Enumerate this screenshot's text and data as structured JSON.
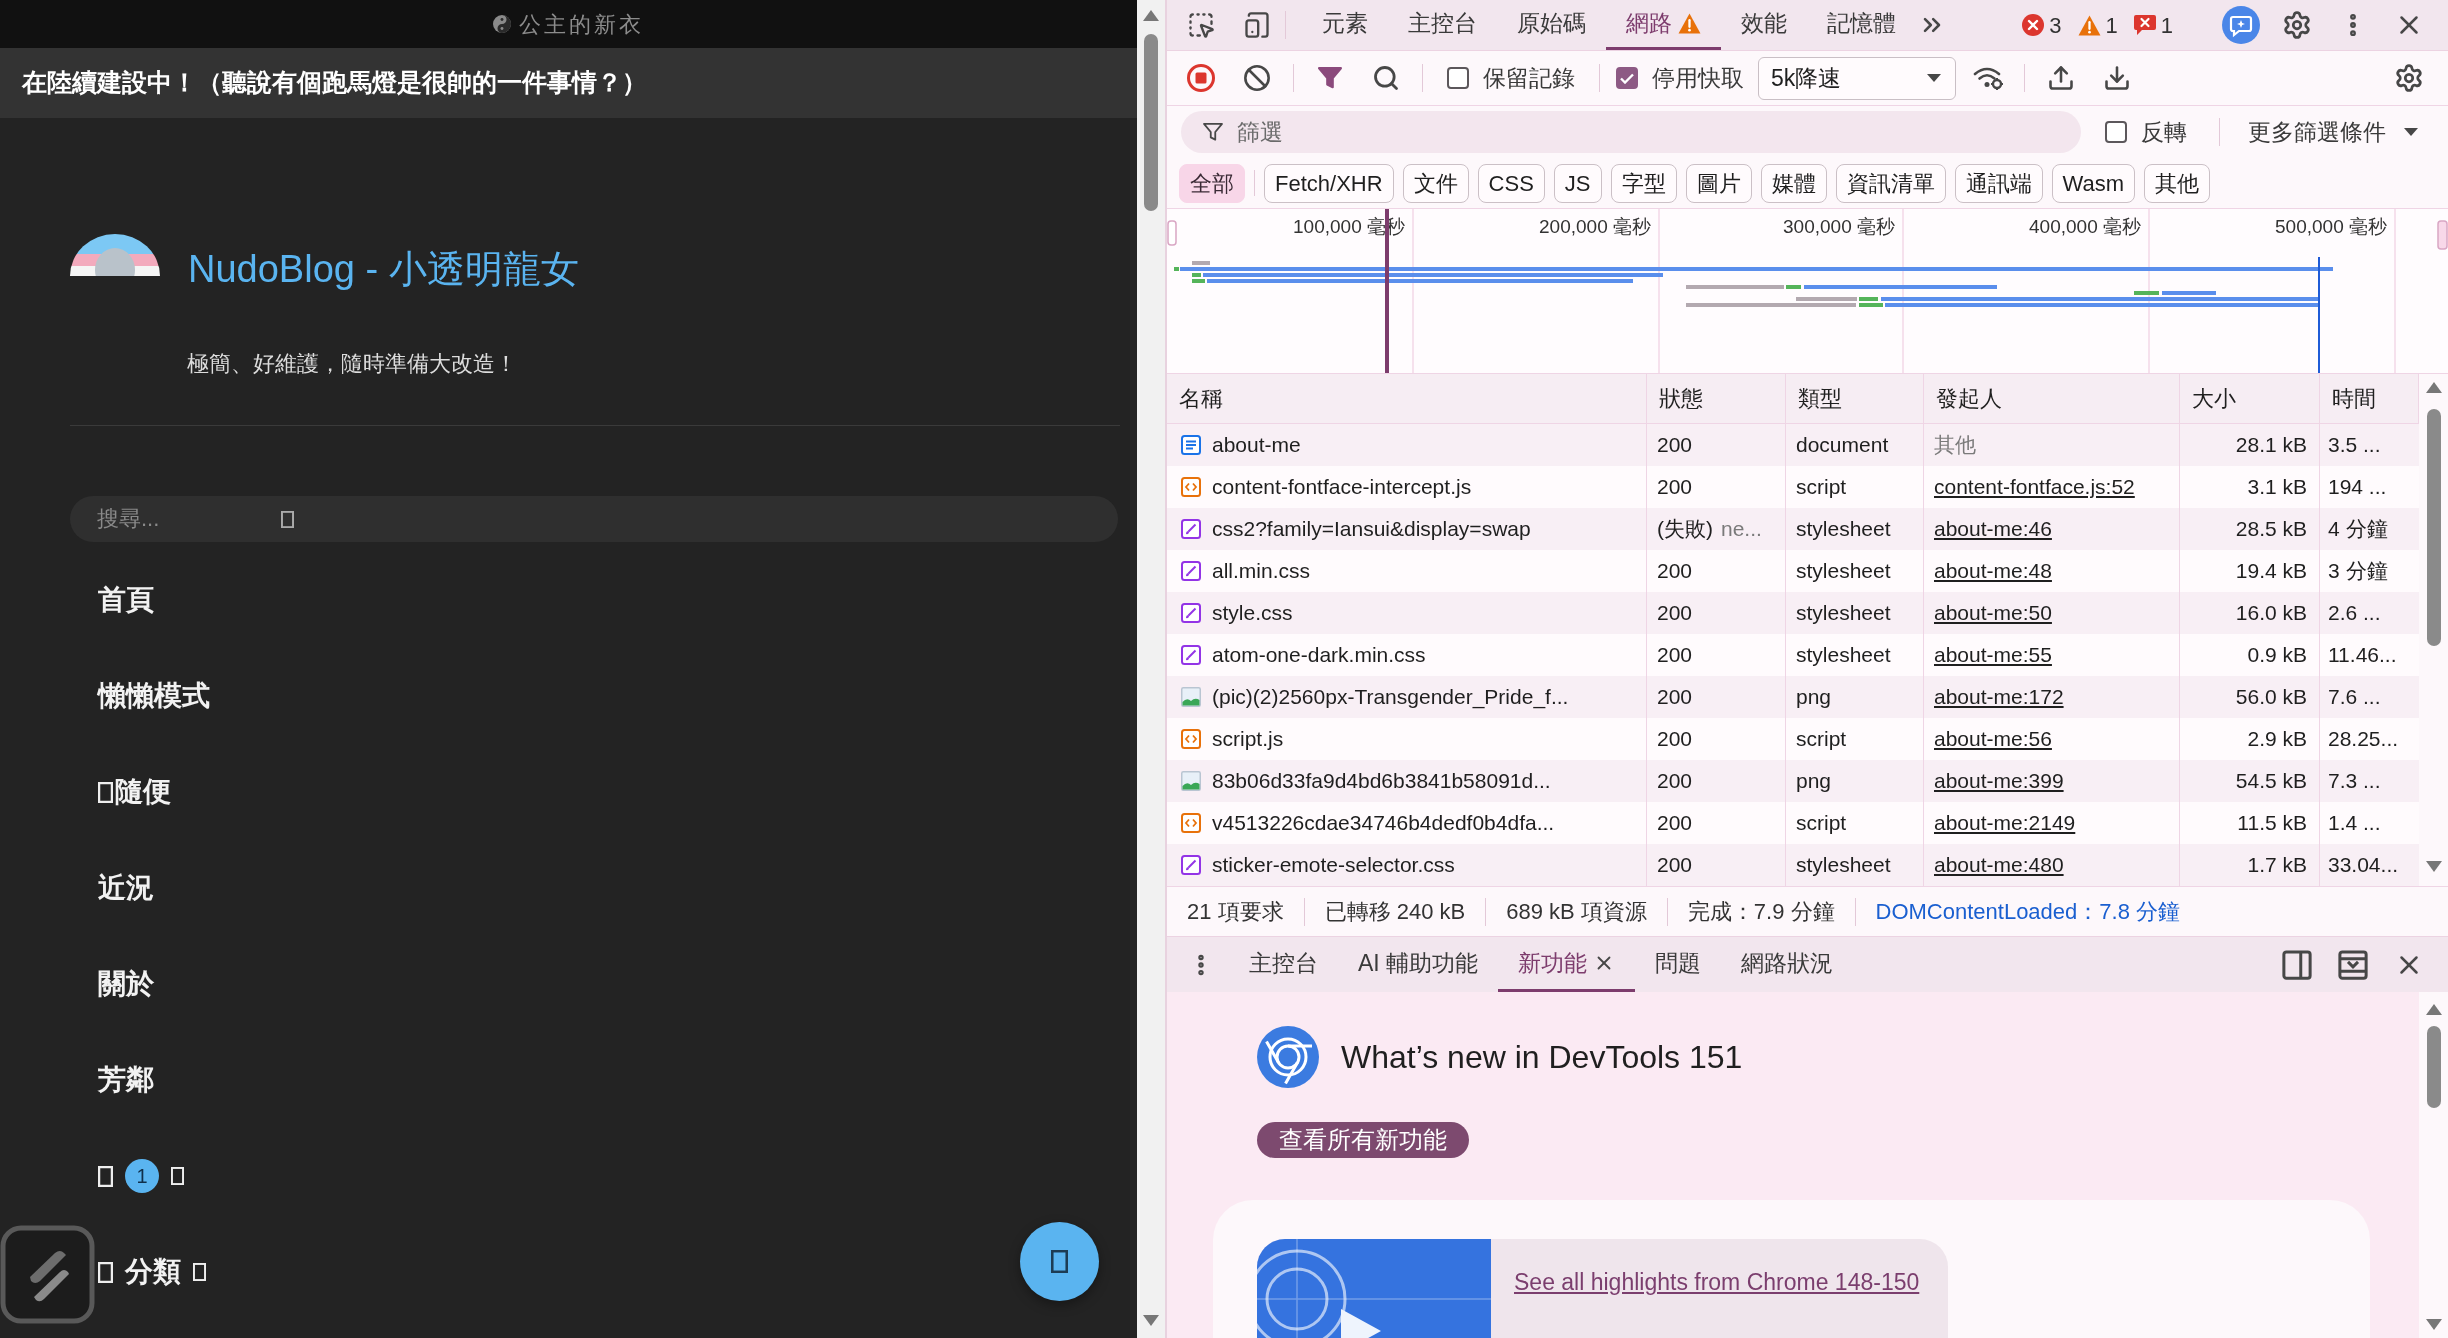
{
  "blog": {
    "top_bar": {
      "title": "公主的新衣"
    },
    "marquee": "在陸續建設中！（聽說有個跑馬燈是很帥的一件事情？）",
    "site_title": "NudoBlog - 小透明龍女",
    "tagline": "極簡、好維護，隨時準備大改造！",
    "search": {
      "placeholder": "搜尋..."
    },
    "nav": [
      {
        "label": "首頁"
      },
      {
        "label": "懶懶模式"
      },
      {
        "label": "隨便",
        "leading_glyph": true
      },
      {
        "label": "近況"
      },
      {
        "label": "關於"
      },
      {
        "label": "芳鄰"
      },
      {
        "badge": "1",
        "leading_glyph": true,
        "trailing_glyph": true
      },
      {
        "label": "分類",
        "leading_glyph": true,
        "trailing_glyph": true
      }
    ]
  },
  "devtools": {
    "main_tabs": [
      {
        "label": "元素",
        "selected": false,
        "warning": false
      },
      {
        "label": "主控台",
        "selected": false,
        "warning": false
      },
      {
        "label": "原始碼",
        "selected": false,
        "warning": false
      },
      {
        "label": "網路",
        "selected": true,
        "warning": true
      },
      {
        "label": "效能",
        "selected": false,
        "warning": false
      },
      {
        "label": "記憶體",
        "selected": false,
        "warning": false
      }
    ],
    "counts": [
      {
        "kind": "error",
        "count": "3"
      },
      {
        "kind": "warning",
        "count": "1"
      },
      {
        "kind": "issue",
        "count": "1"
      }
    ],
    "toolbar": {
      "recording": true,
      "filter_on": true,
      "preserve_log": {
        "label": "保留記錄",
        "checked": false
      },
      "disable_cache": {
        "label": "停用快取",
        "checked": true
      },
      "throttling": {
        "value": "5k降速"
      }
    },
    "filter": {
      "placeholder": "篩選",
      "invert": {
        "label": "反轉",
        "checked": false
      },
      "more_filters": "更多篩選條件"
    },
    "type_filters": [
      {
        "label": "全部",
        "selected": true
      },
      {
        "label": "Fetch/XHR",
        "selected": false
      },
      {
        "label": "文件",
        "selected": false
      },
      {
        "label": "CSS",
        "selected": false
      },
      {
        "label": "JS",
        "selected": false
      },
      {
        "label": "字型",
        "selected": false
      },
      {
        "label": "圖片",
        "selected": false
      },
      {
        "label": "媒體",
        "selected": false
      },
      {
        "label": "資訊清單",
        "selected": false
      },
      {
        "label": "通訊端",
        "selected": false
      },
      {
        "label": "Wasm",
        "selected": false
      },
      {
        "label": "其他",
        "selected": false
      }
    ],
    "overview": {
      "ticks": [
        "100,000 毫秒",
        "200,000 毫秒",
        "300,000 毫秒",
        "400,000 毫秒",
        "500,000 毫秒"
      ]
    },
    "table": {
      "columns": [
        "名稱",
        "狀態",
        "類型",
        "發起人",
        "大小",
        "時間"
      ],
      "rows": [
        {
          "kind": "document",
          "name": "about-me",
          "status": "200",
          "type": "document",
          "initiator": "其他",
          "initiator_link": false,
          "size": "28.1 kB",
          "time": "3.5 ..."
        },
        {
          "kind": "script",
          "name": "content-fontface-intercept.js",
          "status": "200",
          "type": "script",
          "initiator": "content-fontface.js:52",
          "initiator_link": true,
          "size": "3.1 kB",
          "time": "194 ..."
        },
        {
          "kind": "stylesheet",
          "name": "css2?family=Iansui&display=swap",
          "status": "(失敗)",
          "status_detail": "ne...",
          "type": "stylesheet",
          "initiator": "about-me:46",
          "initiator_link": true,
          "size": "28.5 kB",
          "time": "4 分鐘"
        },
        {
          "kind": "stylesheet",
          "name": "all.min.css",
          "status": "200",
          "type": "stylesheet",
          "initiator": "about-me:48",
          "initiator_link": true,
          "size": "19.4 kB",
          "time": "3 分鐘"
        },
        {
          "kind": "stylesheet",
          "name": "style.css",
          "status": "200",
          "type": "stylesheet",
          "initiator": "about-me:50",
          "initiator_link": true,
          "size": "16.0 kB",
          "time": "2.6 ..."
        },
        {
          "kind": "stylesheet",
          "name": "atom-one-dark.min.css",
          "status": "200",
          "type": "stylesheet",
          "initiator": "about-me:55",
          "initiator_link": true,
          "size": "0.9 kB",
          "time": "11.46..."
        },
        {
          "kind": "image",
          "name": "(pic)(2)2560px-Transgender_Pride_f...",
          "status": "200",
          "type": "png",
          "initiator": "about-me:172",
          "initiator_link": true,
          "size": "56.0 kB",
          "time": "7.6 ..."
        },
        {
          "kind": "script",
          "name": "script.js",
          "status": "200",
          "type": "script",
          "initiator": "about-me:56",
          "initiator_link": true,
          "size": "2.9 kB",
          "time": "28.25..."
        },
        {
          "kind": "image",
          "name": "83b06d33fa9d4bd6b3841b58091d...",
          "status": "200",
          "type": "png",
          "initiator": "about-me:399",
          "initiator_link": true,
          "size": "54.5 kB",
          "time": "7.3 ..."
        },
        {
          "kind": "script",
          "name": "v4513226cdae34746b4dedf0b4dfa...",
          "status": "200",
          "type": "script",
          "initiator": "about-me:2149",
          "initiator_link": true,
          "size": "11.5 kB",
          "time": "1.4 ..."
        },
        {
          "kind": "stylesheet",
          "name": "sticker-emote-selector.css",
          "status": "200",
          "type": "stylesheet",
          "initiator": "about-me:480",
          "initiator_link": true,
          "size": "1.7 kB",
          "time": "33.04..."
        }
      ]
    },
    "summary": [
      {
        "kind": "stat",
        "text": "21 項要求"
      },
      {
        "kind": "stat",
        "text": "已轉移 240 kB"
      },
      {
        "kind": "stat",
        "text": "689 kB 項資源"
      },
      {
        "kind": "stat",
        "text": "完成：7.9 分鐘"
      },
      {
        "kind": "event",
        "text": "DOMContentLoaded：7.8 分鐘"
      }
    ],
    "drawer": {
      "tabs": [
        {
          "label": "主控台",
          "selected": false,
          "closable": false
        },
        {
          "label": "AI 輔助功能",
          "selected": false,
          "closable": false
        },
        {
          "label": "新功能",
          "selected": true,
          "closable": true
        },
        {
          "label": "問題",
          "selected": false,
          "closable": false
        },
        {
          "label": "網路狀況",
          "selected": false,
          "closable": false
        }
      ],
      "whats_new": {
        "title": "What’s new in DevTools 151",
        "button": "查看所有新功能",
        "highlight_link": "See all highlights from Chrome 148-150"
      }
    }
  }
}
